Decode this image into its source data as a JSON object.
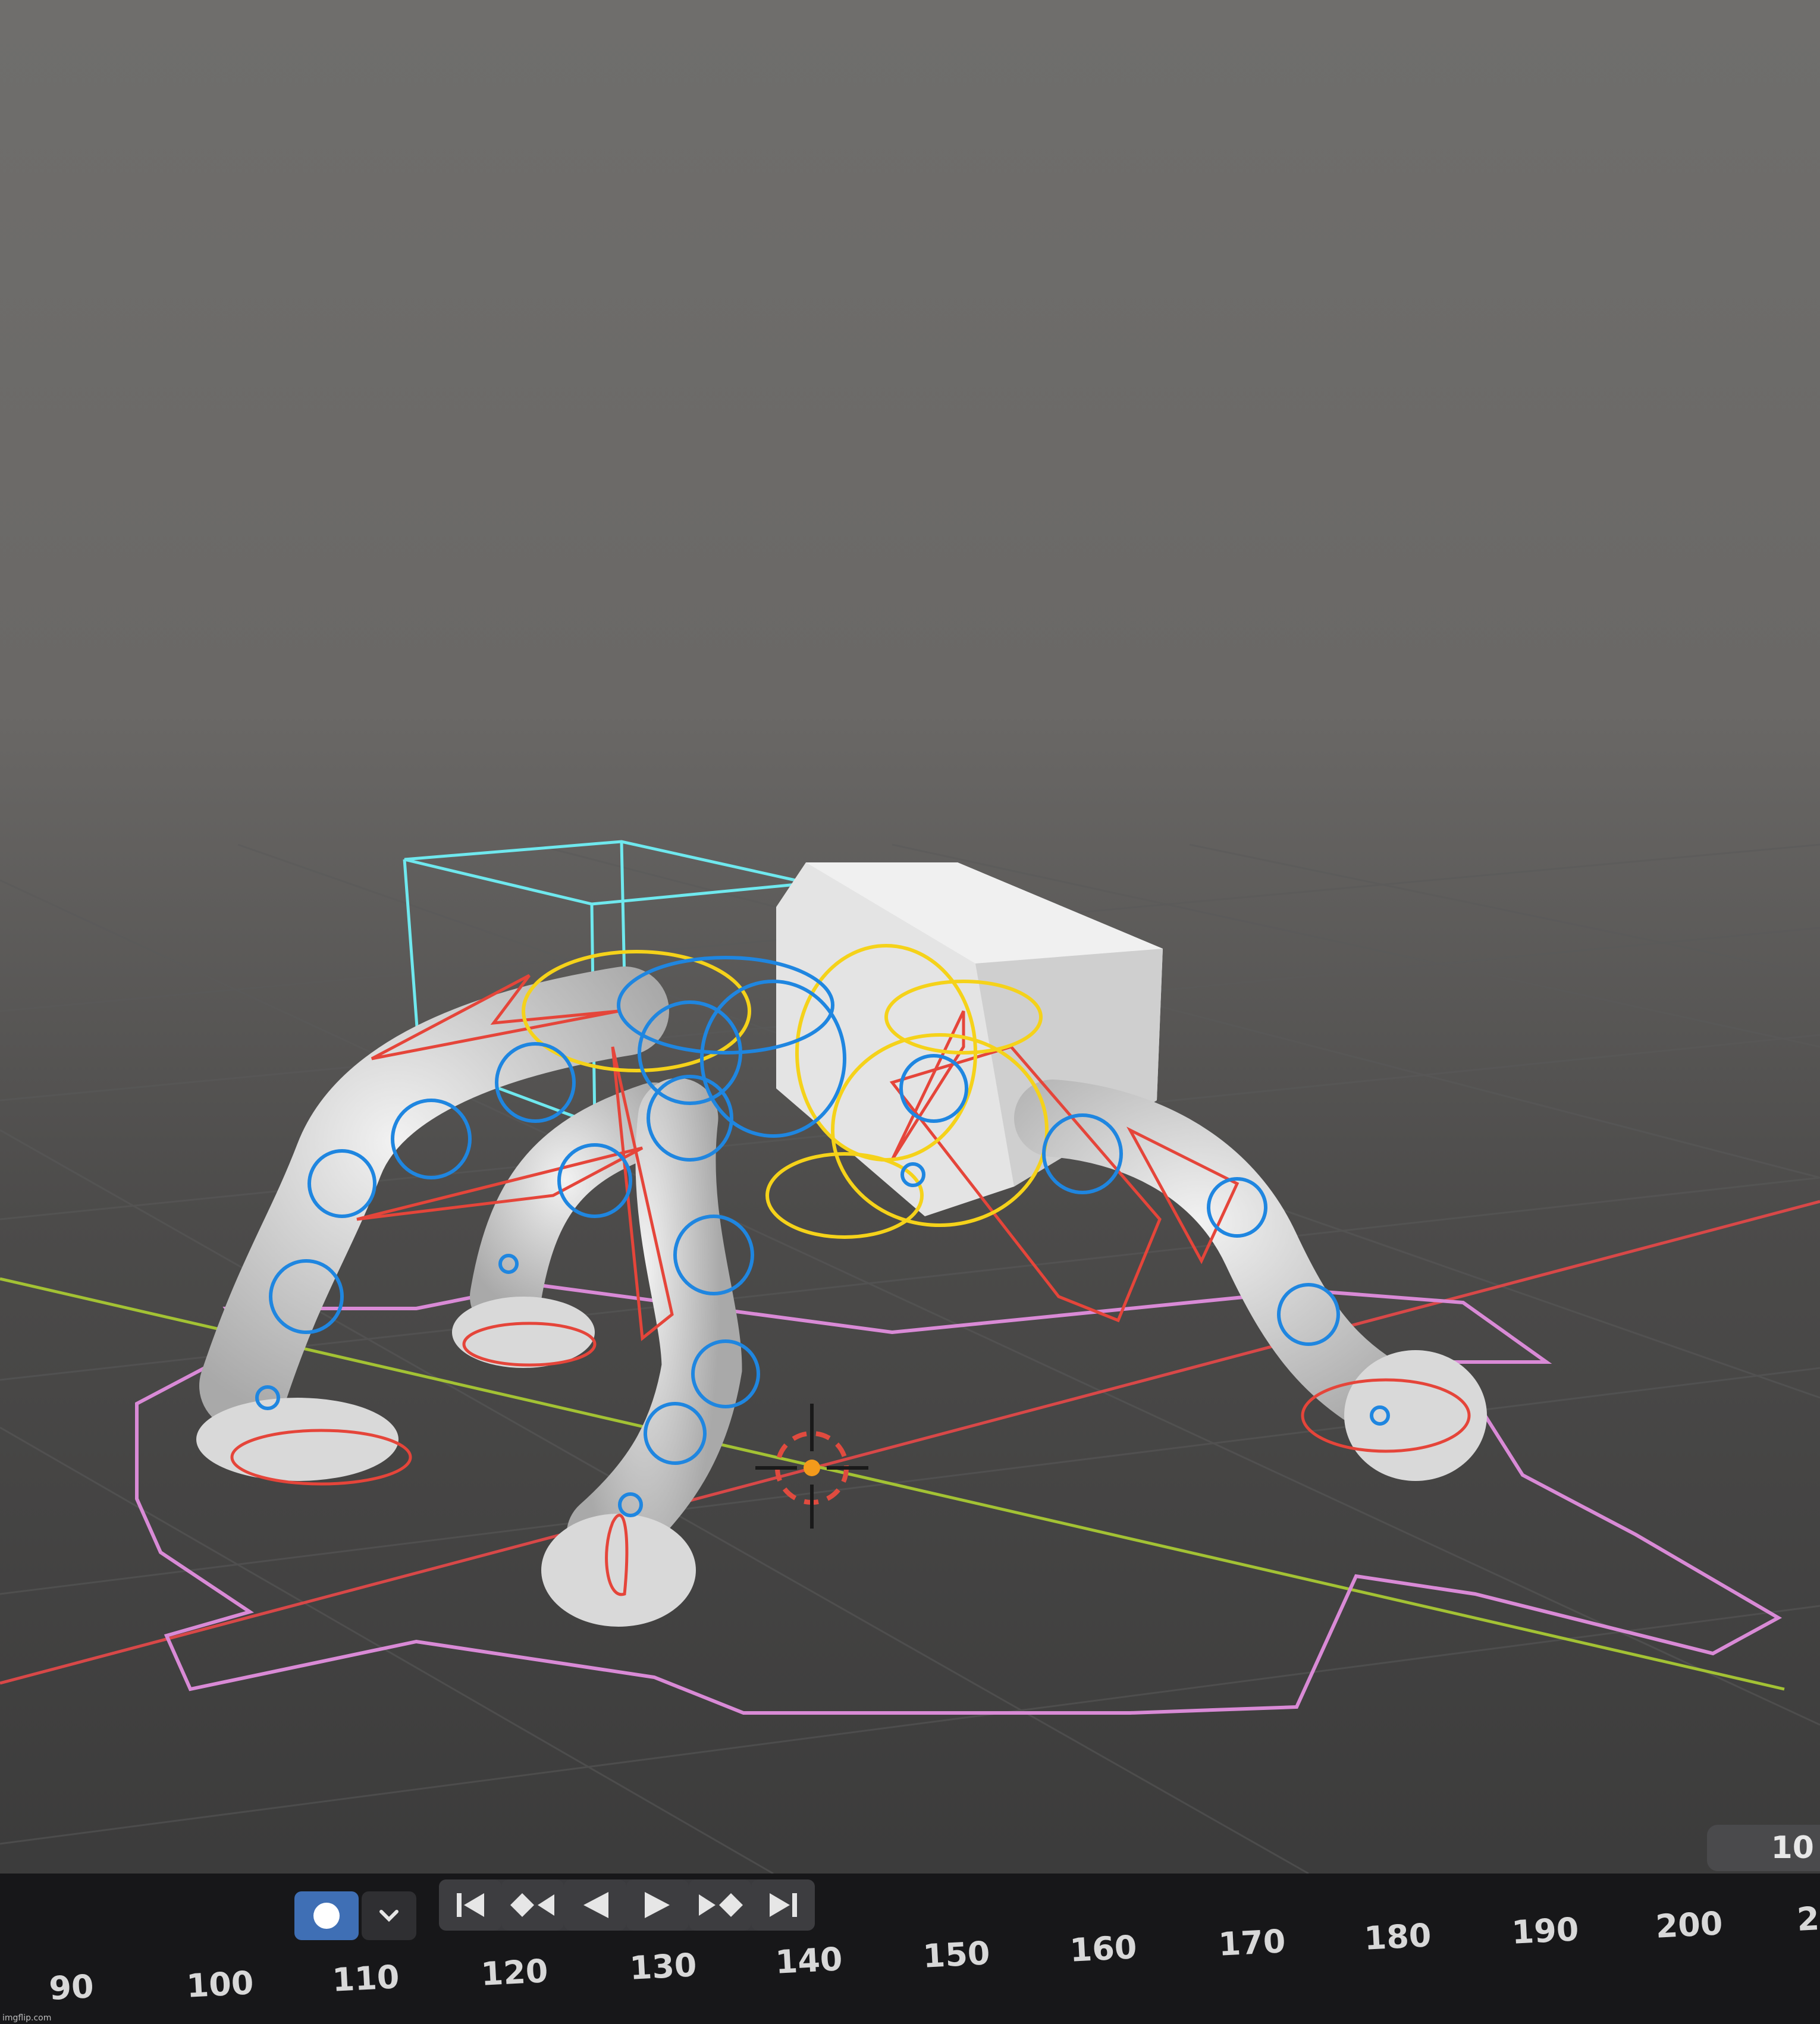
{
  "viewport": {
    "background_top": "#6f6d6b",
    "background_bottom": "#3a3a3a",
    "colors": {
      "cage_cyan": "#6fe8ee",
      "bone_blue": "#1f86e0",
      "bone_red": "#e5453a",
      "bone_yellow": "#f5d21a",
      "root_pink": "#d98ad6",
      "axis_x_red": "#d84848",
      "axis_y_green": "#a3c234",
      "mesh_white": "#e6e6e6"
    }
  },
  "current_frame": "10",
  "timeline": {
    "record_icon": "record-dot-icon",
    "record_dropdown_icon": "chevron-down-icon",
    "playback_buttons": [
      {
        "name": "jump-to-start",
        "icon": "jump-start-icon"
      },
      {
        "name": "previous-keyframe",
        "icon": "prev-keyframe-icon"
      },
      {
        "name": "play-reverse",
        "icon": "play-reverse-icon"
      },
      {
        "name": "play",
        "icon": "play-icon"
      },
      {
        "name": "next-keyframe",
        "icon": "next-keyframe-icon"
      },
      {
        "name": "jump-to-end",
        "icon": "jump-end-icon"
      }
    ],
    "ruler_labels": [
      "90",
      "100",
      "110",
      "120",
      "130",
      "140",
      "150",
      "160",
      "170",
      "180",
      "190",
      "200",
      "2"
    ]
  },
  "watermark": "imgflip.com"
}
